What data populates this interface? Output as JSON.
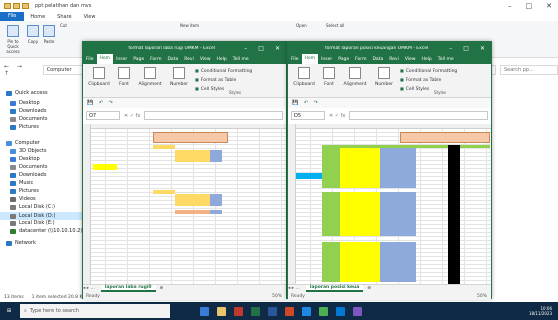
{
  "explorer": {
    "title": "ppt pelatihan dan mvs",
    "tabs": [
      "File",
      "Home",
      "Share",
      "View"
    ],
    "ribbon": {
      "pin_label": "Pin to Quick access",
      "copy_label": "Copy",
      "paste_label": "Paste",
      "cut_label": "Cut",
      "new_item_label": "New item",
      "open_label": "Open",
      "select_all_label": "Select all"
    },
    "address": "Computer",
    "search_placeholder": "Search pp...",
    "nav_items": [
      {
        "label": "Quick access",
        "color": "#2b78c5"
      },
      {
        "label": "Desktop",
        "color": "#3a7bd5"
      },
      {
        "label": "Downloads",
        "color": "#2b78c5"
      },
      {
        "label": "Documents",
        "color": "#8a8a8a"
      },
      {
        "label": "Pictures",
        "color": "#2b78c5"
      },
      {
        "label": "Computer",
        "color": "#4a90d9"
      },
      {
        "label": "3D Objects",
        "color": "#4a90d9"
      },
      {
        "label": "Desktop",
        "color": "#3a7bd5"
      },
      {
        "label": "Documents",
        "color": "#8a8a8a"
      },
      {
        "label": "Downloads",
        "color": "#2b78c5"
      },
      {
        "label": "Music",
        "color": "#2b78c5"
      },
      {
        "label": "Pictures",
        "color": "#2b78c5"
      },
      {
        "label": "Videos",
        "color": "#6a6a6a"
      },
      {
        "label": "Local Disk (C:)",
        "color": "#7a7a7a"
      },
      {
        "label": "Local Disk (D:)",
        "color": "#7a7a7a"
      },
      {
        "label": "Local Disk (E:)",
        "color": "#7a7a7a"
      },
      {
        "label": "datacenter (\\\\10.10.10.2)",
        "color": "#2e7d32"
      },
      {
        "label": "Network",
        "color": "#2b78c5"
      }
    ],
    "status": {
      "items": "13 items",
      "selected": "1 item selected 20.8 KB"
    }
  },
  "excel_left": {
    "title": "format laporan laba rugi UMKM - Excel",
    "tabs": [
      "File",
      "Hom",
      "Inser",
      "Page",
      "Form",
      "Data",
      "Revi",
      "View",
      "Help",
      "Tell me"
    ],
    "ribbon": {
      "clipboard": "Clipboard",
      "font": "Font",
      "alignment": "Alignment",
      "number": "Number",
      "styles_items": [
        "Conditional Formatting",
        "Format as Table",
        "Cell Styles"
      ],
      "styles_label": "Styles"
    },
    "name_box": "O7",
    "sheet_tab": "laporan laba rugi0",
    "status": "Ready",
    "zoom": "50%"
  },
  "excel_right": {
    "title": "format laporan posisi keuangan UMKM - Excel",
    "tabs": [
      "File",
      "Hom",
      "Inser",
      "Page",
      "Form",
      "Data",
      "Revi",
      "View",
      "Help",
      "Tell me"
    ],
    "ribbon": {
      "clipboard": "Clipboard",
      "font": "Font",
      "alignment": "Alignment",
      "number": "Number",
      "styles_items": [
        "Conditional Formatting",
        "Format as Table",
        "Cell Styles"
      ],
      "styles_label": "Styles"
    },
    "name_box": "D5",
    "sheet_tab": "laporan posisi keua",
    "status": "Ready",
    "zoom": "50%"
  },
  "taskbar": {
    "search_placeholder": "Type here to search",
    "time": "10:06",
    "date": "18/11/2023"
  }
}
